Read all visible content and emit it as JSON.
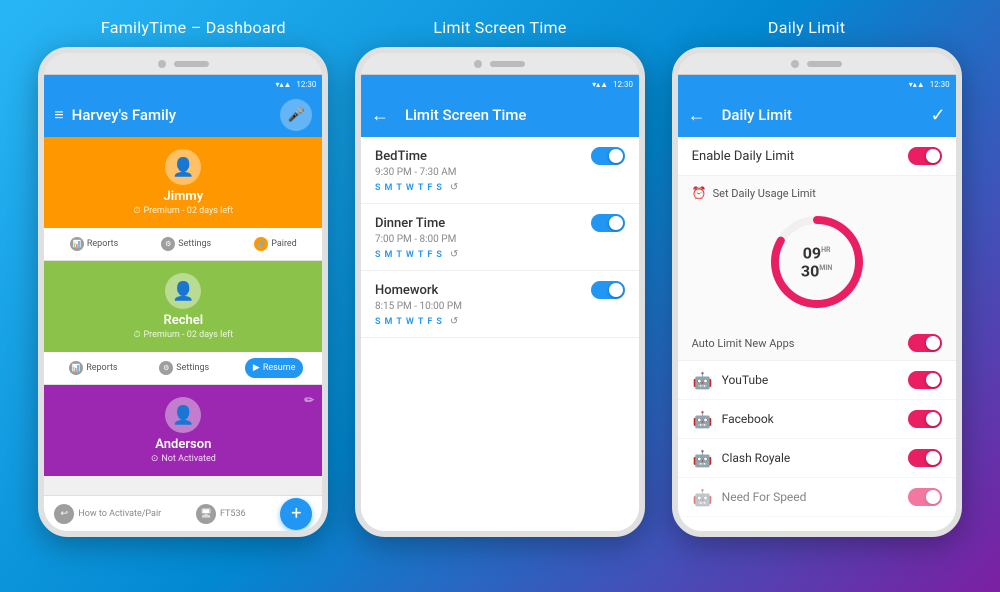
{
  "titles": {
    "phone1": "FamilyTime – Dashboard",
    "phone2": "Limit Screen Time",
    "phone3": "Daily Limit"
  },
  "status_bar": {
    "time": "12:30",
    "icons": "▾ ✦ ▲ 📶"
  },
  "phone1": {
    "app_bar_title": "Harvey's Family",
    "users": [
      {
        "name": "Jimmy",
        "status": "Premium - 02 days left",
        "color": "orange"
      },
      {
        "name": "Rechel",
        "status": "Premium - 02 days left",
        "color": "green"
      },
      {
        "name": "Anderson",
        "status": "Not Activated",
        "color": "purple"
      }
    ],
    "actions": {
      "reports": "Reports",
      "settings": "Settings",
      "paired": "Paired",
      "resume": "Resume"
    },
    "bottom": {
      "activate": "How to Activate/Pair",
      "ft": "FT536"
    }
  },
  "phone2": {
    "app_bar_title": "Limit Screen Time",
    "schedules": [
      {
        "name": "BedTime",
        "time": "9:30 PM - 7:30 AM",
        "days": [
          "S",
          "M",
          "T",
          "W",
          "T",
          "F",
          "S"
        ],
        "active_days": [
          0,
          1,
          2,
          3,
          4,
          5,
          6
        ],
        "enabled": true
      },
      {
        "name": "Dinner Time",
        "time": "7:00 PM - 8:00 PM",
        "days": [
          "S",
          "M",
          "T",
          "W",
          "T",
          "F",
          "S"
        ],
        "active_days": [
          0,
          1,
          2,
          3,
          4,
          5,
          6
        ],
        "enabled": true
      },
      {
        "name": "Homework",
        "time": "8:15 PM - 10:00 PM",
        "days": [
          "S",
          "M",
          "T",
          "W",
          "T",
          "F",
          "S"
        ],
        "active_days": [
          0,
          1,
          2,
          3,
          4,
          5,
          6
        ],
        "enabled": true
      }
    ]
  },
  "phone3": {
    "app_bar_title": "Daily Limit",
    "enable_label": "Enable Daily Limit",
    "enabled": true,
    "usage_limit_title": "Set Daily Usage Limit",
    "timer": {
      "hours": "09",
      "hours_sup": "HR",
      "minutes": "30",
      "minutes_sup": "MIN"
    },
    "auto_limit_label": "Auto Limit New Apps",
    "apps": [
      {
        "name": "YouTube",
        "enabled": true
      },
      {
        "name": "Facebook",
        "enabled": true
      },
      {
        "name": "Clash Royale",
        "enabled": true
      },
      {
        "name": "Need For Speed",
        "enabled": true
      }
    ]
  }
}
